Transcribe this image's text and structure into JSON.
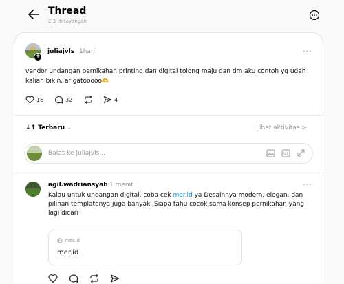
{
  "header": {
    "title": "Thread",
    "subtitle": "2,3 rb tayangan"
  },
  "post": {
    "username": "juliajvls",
    "time": "1hari",
    "more": "···",
    "text": "vendor undangan pernikahan printing dan digital tolong maju dan dm aku contoh yg udah kalian bikin. arigatooooo",
    "emoji": "🫶",
    "stats": {
      "likes": "16",
      "replies": "32",
      "shares": "4"
    }
  },
  "sort": {
    "label": "Terbaru",
    "activity": "Lihat aktivitas >"
  },
  "reply_box": {
    "placeholder": "Balas ke juliajvls..."
  },
  "comment": {
    "username": "agil.wadriansyah",
    "time": "1 menit",
    "more": "···",
    "text_before": "Kalau untuk undangan digital, coba cek ",
    "link": "mer.id",
    "text_after": " ya Desainnya modern, elegan, dan pilihan templatenya juga banyak. Siapa tahu cocok sama konsep pernikahan yang lagi dicari",
    "link_card": {
      "domain": "mer.id",
      "title": "mer.id"
    }
  },
  "icons": {
    "back": "arrow-left-icon",
    "more_circle": "more-circle-icon",
    "like": "heart-icon",
    "reply": "comment-icon",
    "repost": "repost-icon",
    "share": "send-icon",
    "image": "image-icon",
    "gif": "gif-icon",
    "expand": "expand-icon",
    "globe": "globe-icon"
  },
  "colors": {
    "link": "#0a95e8",
    "muted": "#999999"
  }
}
